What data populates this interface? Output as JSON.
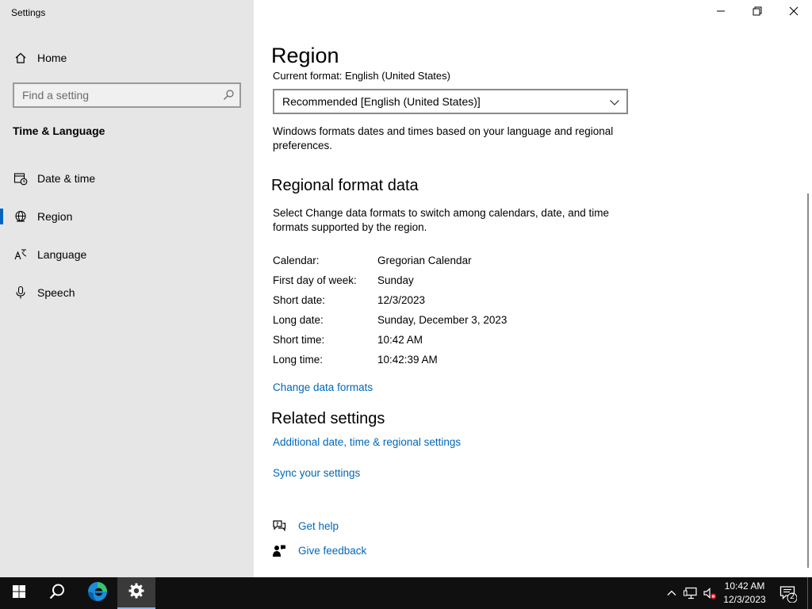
{
  "window": {
    "app_title": "Settings",
    "controls": {
      "minimize": "minimize-icon",
      "restore": "restore-icon",
      "close": "close-icon"
    }
  },
  "sidebar": {
    "home_label": "Home",
    "search": {
      "placeholder": "Find a setting",
      "value": ""
    },
    "section_heading": "Time & Language",
    "items": [
      {
        "label": "Date & time",
        "icon": "date-time-icon"
      },
      {
        "label": "Region",
        "icon": "globe-icon",
        "active": true
      },
      {
        "label": "Language",
        "icon": "language-icon"
      },
      {
        "label": "Speech",
        "icon": "microphone-icon"
      }
    ]
  },
  "main": {
    "title": "Region",
    "current_format_text": "Current format: English (United States)",
    "format_dropdown": {
      "selected": "Recommended [English (United States)]"
    },
    "format_description": "Windows formats dates and times based on your language and regional preferences.",
    "regional_format_heading": "Regional format data",
    "regional_format_description": "Select Change data formats to switch among calendars, date, and time formats supported by the region.",
    "format_rows": [
      {
        "label": "Calendar:",
        "value": "Gregorian Calendar"
      },
      {
        "label": "First day of week:",
        "value": "Sunday"
      },
      {
        "label": "Short date:",
        "value": "12/3/2023"
      },
      {
        "label": "Long date:",
        "value": "Sunday, December 3, 2023"
      },
      {
        "label": "Short time:",
        "value": "10:42 AM"
      },
      {
        "label": "Long time:",
        "value": "10:42:39 AM"
      }
    ],
    "change_formats_link": "Change data formats",
    "related_heading": "Related settings",
    "related_links": [
      "Additional date, time & regional settings",
      "Sync your settings"
    ],
    "help_links": [
      {
        "label": "Get help",
        "icon": "get-help-icon"
      },
      {
        "label": "Give feedback",
        "icon": "feedback-icon"
      }
    ]
  },
  "taskbar": {
    "buttons": [
      "start-icon",
      "search-icon",
      "edge-icon",
      "settings-icon"
    ],
    "tray": [
      "chevron-up-icon",
      "network-icon",
      "volume-muted-icon"
    ],
    "clock_time": "10:42 AM",
    "clock_date": "12/3/2023",
    "notification_count": "2"
  },
  "colors": {
    "sidebar_bg": "#e6e6e6",
    "accent": "#0067c0",
    "link": "#0067b8",
    "taskbar_bg": "#101010"
  }
}
